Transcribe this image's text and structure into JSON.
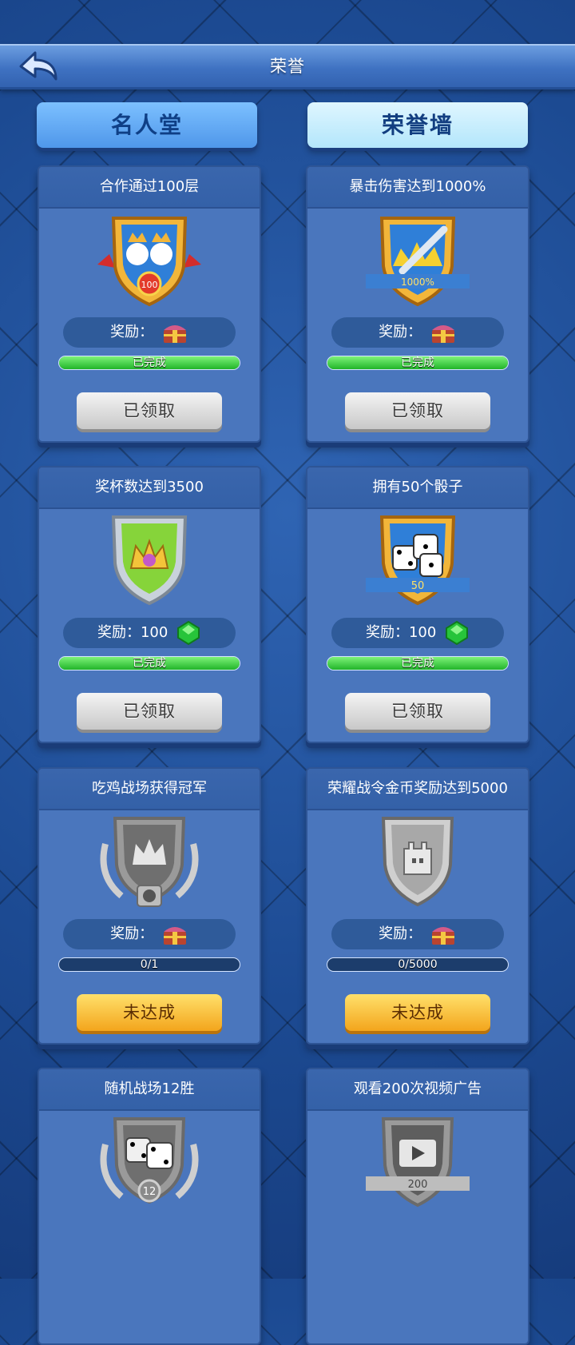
{
  "header": {
    "title": "荣誉"
  },
  "tabs": [
    {
      "label": "名人堂"
    },
    {
      "label": "荣誉墙"
    }
  ],
  "reward_label": "奖励：",
  "cards": [
    {
      "title": "合作通过100层",
      "badge": "shield-100",
      "reward_type": "chest",
      "reward_text": "奖励：",
      "progress": 1,
      "progress_text": "已完成",
      "button": "已领取",
      "status": "claimed"
    },
    {
      "title": "暴击伤害达到1000%",
      "badge": "shield-1000%",
      "reward_type": "chest",
      "reward_text": "奖励：",
      "progress": 1,
      "progress_text": "已完成",
      "button": "已领取",
      "status": "claimed"
    },
    {
      "title": "奖杯数达到3500",
      "badge": "shield-crown",
      "reward_type": "gem",
      "reward_text": "奖励：100",
      "progress": 1,
      "progress_text": "已完成",
      "button": "已领取",
      "status": "claimed"
    },
    {
      "title": "拥有50个骰子",
      "badge": "shield-50",
      "reward_type": "gem",
      "reward_text": "奖励：100",
      "progress": 1,
      "progress_text": "已完成",
      "button": "已领取",
      "status": "claimed"
    },
    {
      "title": "吃鸡战场获得冠军",
      "badge": "silver-crown",
      "reward_type": "chest",
      "reward_text": "奖励：",
      "progress": 0,
      "progress_text": "0/1",
      "button": "未达成",
      "status": "undone"
    },
    {
      "title": "荣耀战令金币奖励达到5000",
      "badge": "silver-castle",
      "reward_type": "chest",
      "reward_text": "奖励：",
      "progress": 0,
      "progress_text": "0/5000",
      "button": "未达成",
      "status": "undone"
    },
    {
      "title": "随机战场12胜",
      "badge": "silver-12",
      "reward_type": "none",
      "reward_text": "",
      "progress": null,
      "progress_text": "",
      "button": "",
      "status": "partial"
    },
    {
      "title": "观看200次视频广告",
      "badge": "silver-200",
      "reward_type": "none",
      "reward_text": "",
      "progress": null,
      "progress_text": "",
      "button": "",
      "status": "partial"
    }
  ],
  "colors": {
    "gold_badge": "#f2b63a",
    "silver_badge": "#b8b8b8",
    "progress_green": "#33c43a",
    "claimed_button": "#d5d5d5",
    "undone_button": "#f7c23a"
  }
}
